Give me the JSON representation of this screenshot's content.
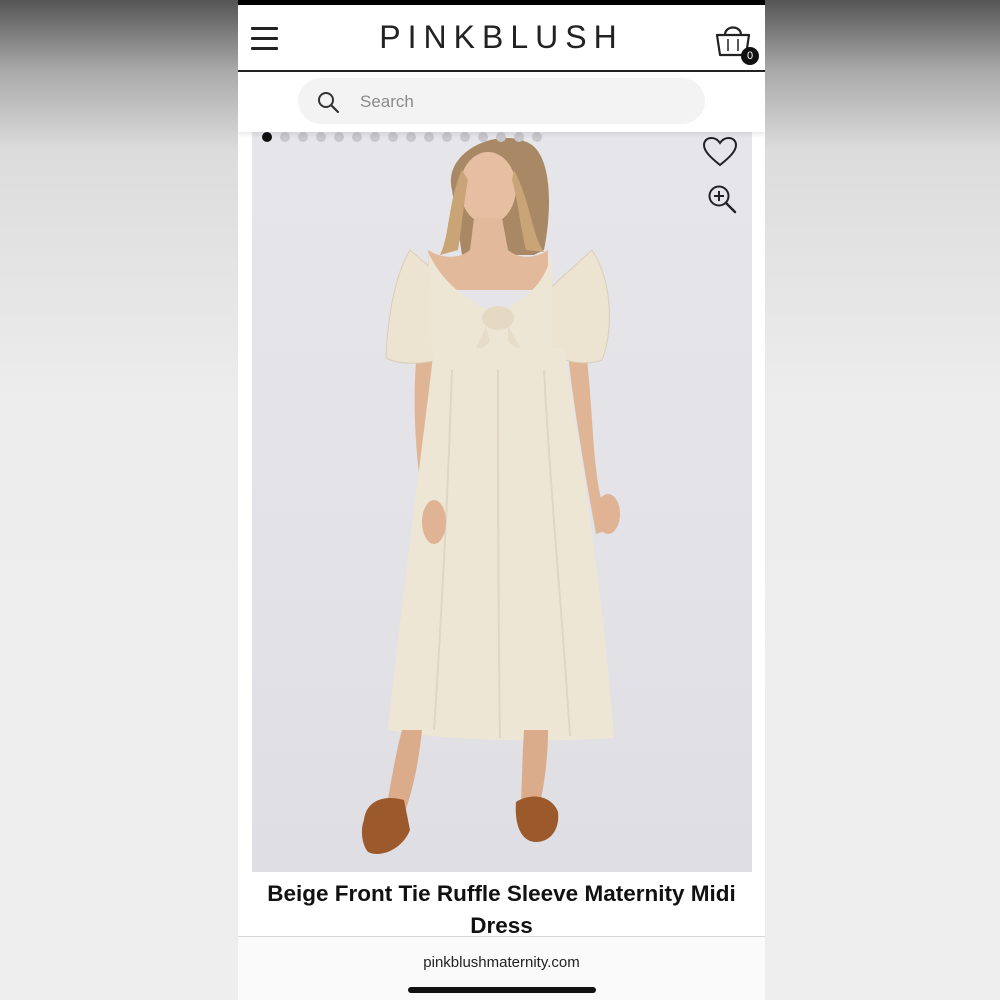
{
  "header": {
    "brand": "PINKBLUSH",
    "cart_count": "0"
  },
  "search": {
    "placeholder": "Search"
  },
  "gallery": {
    "total_images": 16,
    "active_index": 0
  },
  "product": {
    "title": "Beige Front Tie Ruffle Sleeve Maternity Midi Dress"
  },
  "footer": {
    "url": "pinkblushmaternity.com"
  },
  "colors": {
    "dress": "#eee5d4",
    "background": "#e4e4e9",
    "sandals": "#9c5a2c"
  },
  "icons": {
    "menu": "hamburger-menu-icon",
    "cart": "shopping-bag-icon",
    "search": "search-icon",
    "favorite": "heart-icon",
    "zoom": "zoom-in-icon"
  }
}
